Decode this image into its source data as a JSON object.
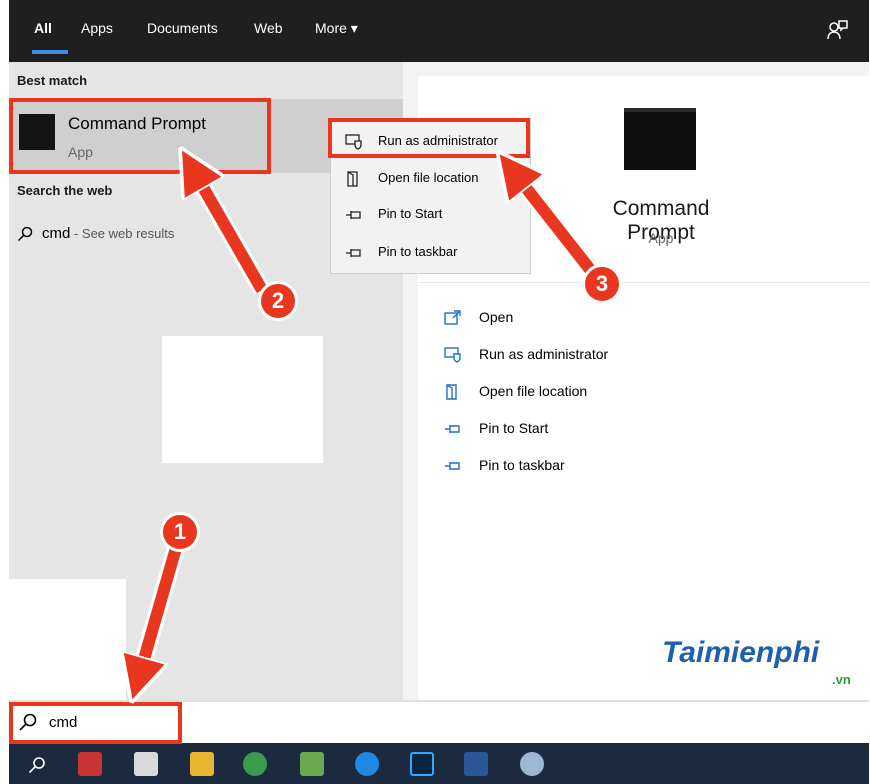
{
  "tabs": [
    {
      "label": "All",
      "active": true
    },
    {
      "label": "Apps"
    },
    {
      "label": "Documents"
    },
    {
      "label": "Web"
    },
    {
      "label": "More"
    }
  ],
  "feedback_icon": "feedback-icon",
  "left": {
    "best_match_header": "Best match",
    "match": {
      "title": "Command Prompt",
      "subtitle": "App",
      "icon": "cmd-app-icon"
    },
    "web_header": "Search the web",
    "web_result": {
      "query": "cmd",
      "suffix": " - See web results",
      "icon": "search-icon"
    }
  },
  "context_menu": [
    {
      "label": "Run as administrator",
      "icon": "shield-run-icon"
    },
    {
      "label": "Open file location",
      "icon": "file-location-icon"
    },
    {
      "label": "Pin to Start",
      "icon": "pin-icon"
    },
    {
      "label": "Pin to taskbar",
      "icon": "pin-icon"
    }
  ],
  "right": {
    "title": "Command Prompt",
    "subtitle": "App",
    "actions": [
      {
        "label": "Open",
        "icon": "open-icon"
      },
      {
        "label": "Run as administrator",
        "icon": "shield-run-icon"
      },
      {
        "label": "Open file location",
        "icon": "file-location-icon"
      },
      {
        "label": "Pin to Start",
        "icon": "pin-icon"
      },
      {
        "label": "Pin to taskbar",
        "icon": "pin-icon"
      }
    ]
  },
  "search": {
    "value": "cmd",
    "icon": "search-icon"
  },
  "taskbar": [
    "search-icon",
    "puzzle-app-icon",
    "paint-app-icon",
    "file-explorer-icon",
    "chrome-icon",
    "notepad-icon",
    "zalo-icon",
    "photoshop-icon",
    "word-icon",
    "paint-palette-icon"
  ],
  "annotations": {
    "badge_1": "1",
    "badge_2": "2",
    "badge_3": "3"
  },
  "watermark": {
    "brand": "Taimienphi",
    "suffix": ".vn"
  },
  "colors": {
    "accent": "#3b8ee4",
    "annotation": "#e8371e",
    "taskbar": "#1b2a3f"
  }
}
